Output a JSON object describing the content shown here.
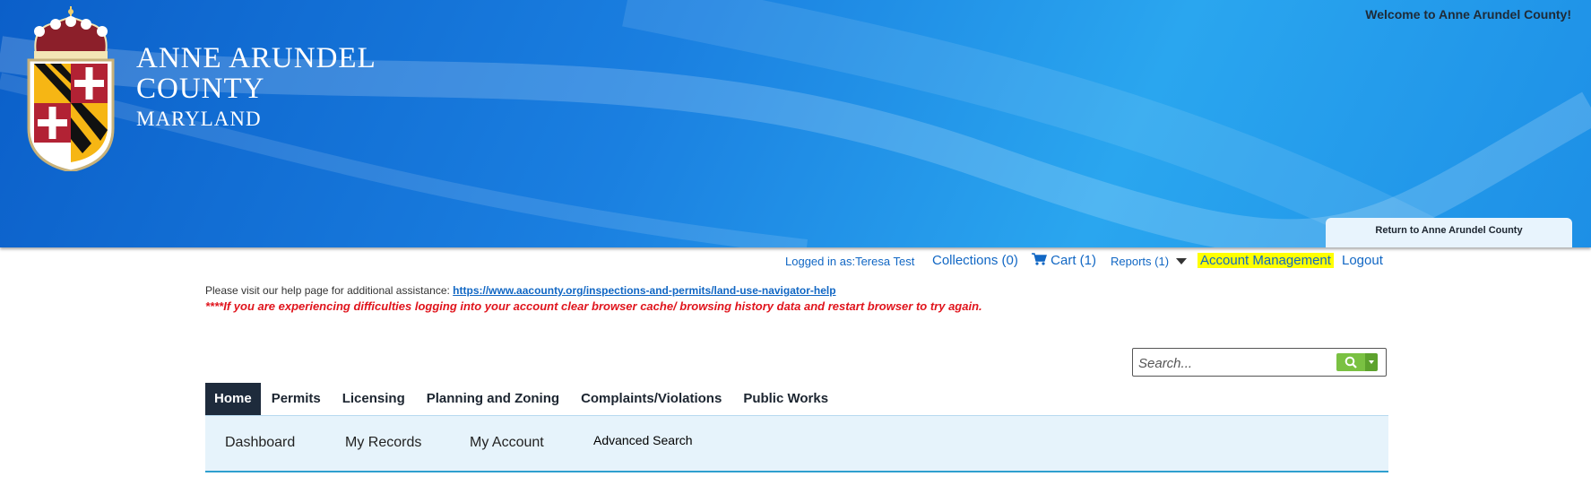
{
  "header": {
    "welcome": "Welcome to Anne Arundel County!",
    "county_line1": "ANNE ARUNDEL",
    "county_line2": "COUNTY",
    "county_line3": "MARYLAND",
    "return_label": "Return to Anne Arundel County"
  },
  "userbar": {
    "logged_in": "Logged in as:Teresa Test",
    "collections": "Collections (0)",
    "cart": "Cart (1)",
    "reports": "Reports (1)",
    "account_management": "Account Management",
    "logout": "Logout"
  },
  "notices": {
    "help_text": "Please visit our help page for additional assistance: ",
    "help_link": "https://www.aacounty.org/inspections-and-permits/land-use-navigator-help",
    "warning": "****If you are experiencing difficulties logging into your account clear browser cache/ browsing history data and restart browser to try again."
  },
  "search": {
    "placeholder": "Search..."
  },
  "nav": {
    "tabs": [
      {
        "label": "Home",
        "active": true
      },
      {
        "label": "Permits"
      },
      {
        "label": "Licensing"
      },
      {
        "label": "Planning and Zoning"
      },
      {
        "label": "Complaints/Violations"
      },
      {
        "label": "Public Works"
      }
    ],
    "subnav": [
      "Dashboard",
      "My Records",
      "My Account",
      "Advanced Search"
    ]
  },
  "colors": {
    "banner": "#1a7fe0",
    "link": "#1167c4",
    "highlight": "#ffff00",
    "warning": "#e0141c",
    "search_button": "#7ac142",
    "active_tab": "#1e2b3c",
    "subnav_bg": "#e6f3fb"
  },
  "icons": [
    "maryland-seal-icon",
    "cart-icon",
    "caret-down-icon",
    "search-icon"
  ]
}
